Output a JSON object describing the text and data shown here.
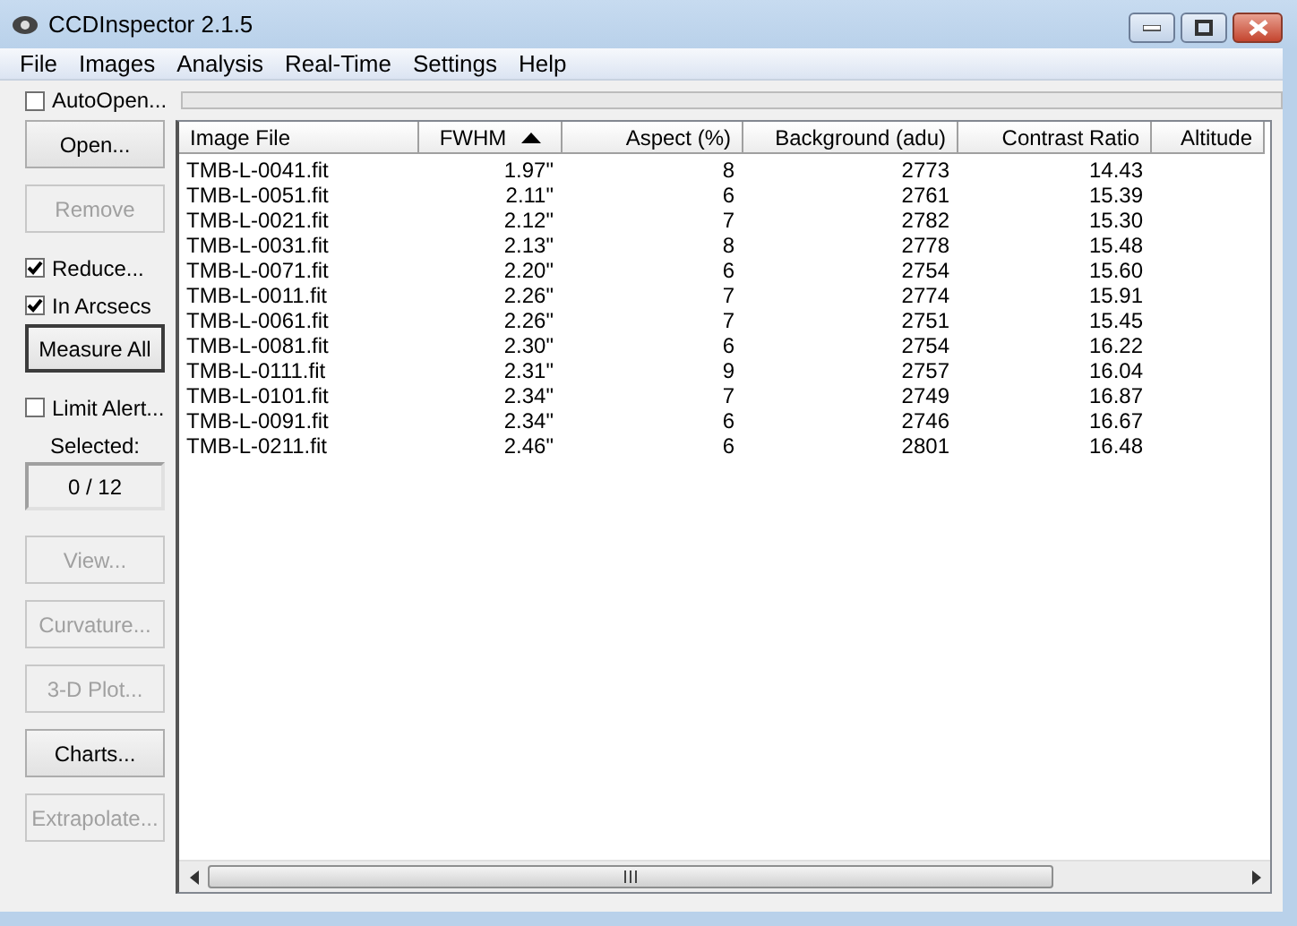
{
  "window": {
    "title": "CCDInspector 2.1.5"
  },
  "menu": [
    "File",
    "Images",
    "Analysis",
    "Real-Time",
    "Settings",
    "Help"
  ],
  "auto_open": {
    "label": "AutoOpen...",
    "checked": false
  },
  "progress": {
    "level": 0
  },
  "sidebar": [
    {
      "kind": "button",
      "label": "Open...",
      "disabled": false
    },
    {
      "kind": "button",
      "label": "Remove",
      "disabled": true
    },
    {
      "kind": "checkbox",
      "label": "Reduce...",
      "checked": true
    },
    {
      "kind": "checkbox",
      "label": "In Arcsecs",
      "checked": true
    },
    {
      "kind": "button",
      "label": "Measure All",
      "disabled": false,
      "default": true
    },
    {
      "kind": "checkbox",
      "label": "Limit Alert...",
      "checked": false
    },
    {
      "kind": "label",
      "label": "Selected:"
    },
    {
      "kind": "readout",
      "label": "0 / 12"
    },
    {
      "kind": "button",
      "label": "View...",
      "disabled": true
    },
    {
      "kind": "button",
      "label": "Curvature...",
      "disabled": true
    },
    {
      "kind": "button",
      "label": "3-D Plot...",
      "disabled": true
    },
    {
      "kind": "button",
      "label": "Charts...",
      "disabled": false
    },
    {
      "kind": "button",
      "label": "Extrapolate...",
      "disabled": true
    }
  ],
  "table": {
    "columns": [
      {
        "label": "Image File",
        "sorted": false
      },
      {
        "label": "FWHM",
        "sorted": true
      },
      {
        "label": "Aspect (%)",
        "sorted": false
      },
      {
        "label": "Background (adu)",
        "sorted": false
      },
      {
        "label": "Contrast Ratio",
        "sorted": false
      },
      {
        "label": "Altitude",
        "sorted": false
      }
    ],
    "rows": [
      [
        "TMB-L-0041.fit",
        "1.97\"",
        "8",
        "2773",
        "14.43"
      ],
      [
        "TMB-L-0051.fit",
        "2.11\"",
        "6",
        "2761",
        "15.39"
      ],
      [
        "TMB-L-0021.fit",
        "2.12\"",
        "7",
        "2782",
        "15.30"
      ],
      [
        "TMB-L-0031.fit",
        "2.13\"",
        "8",
        "2778",
        "15.48"
      ],
      [
        "TMB-L-0071.fit",
        "2.20\"",
        "6",
        "2754",
        "15.60"
      ],
      [
        "TMB-L-0011.fit",
        "2.26\"",
        "7",
        "2774",
        "15.91"
      ],
      [
        "TMB-L-0061.fit",
        "2.26\"",
        "7",
        "2751",
        "15.45"
      ],
      [
        "TMB-L-0081.fit",
        "2.30\"",
        "6",
        "2754",
        "16.22"
      ],
      [
        "TMB-L-0111.fit",
        "2.31\"",
        "9",
        "2757",
        "16.04"
      ],
      [
        "TMB-L-0101.fit",
        "2.34\"",
        "7",
        "2749",
        "16.87"
      ],
      [
        "TMB-L-0091.fit",
        "2.34\"",
        "6",
        "2746",
        "16.67"
      ],
      [
        "TMB-L-0211.fit",
        "2.46\"",
        "6",
        "2801",
        "16.48"
      ]
    ]
  }
}
